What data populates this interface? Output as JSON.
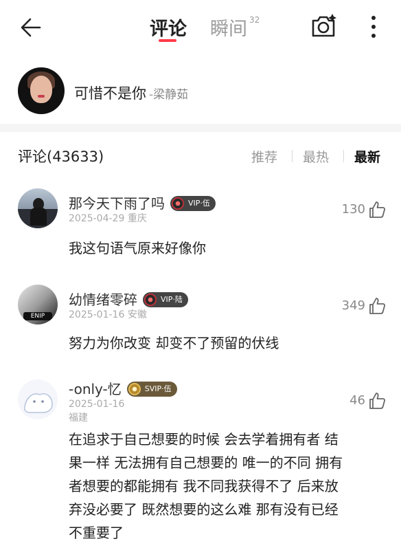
{
  "nav": {
    "tab_comments": "评论",
    "tab_moments": "瞬间",
    "moments_count": "32",
    "accent_color": "#ff3b4a"
  },
  "song": {
    "title": "可惜不是你",
    "separator": "-",
    "artist": "梁静茹"
  },
  "comments_header": {
    "label": "评论(43633)",
    "sort_options": [
      "推荐",
      "最热",
      "最新"
    ],
    "active_sort": "最新"
  },
  "comments": [
    {
      "username": "那今天下雨了吗",
      "vip_label": "VIP·伍",
      "date": "2025-04-29",
      "location": "重庆",
      "likes": "130",
      "text": "我这句语气原来好像你"
    },
    {
      "username": "幼情绪零碎",
      "vip_label": "VIP·陆",
      "date": "2025-01-16",
      "location": "安徽",
      "likes": "349",
      "text": "努力为你改变 却变不了预留的伏线"
    },
    {
      "username": "-only-忆",
      "vip_label": "SVIP·伍",
      "date": "2025-01-16",
      "location": "福建",
      "likes": "46",
      "text_lines": [
        "在追求于自己想要的时候 会去学着拥有者 结",
        "果一样 无法拥有自己想要的 唯一的不同 拥有",
        "者想要的都能拥有 我不同我获得不了 后来放",
        "弃没必要了 既然想要的这么难 那有没有已经",
        "不重要了"
      ]
    }
  ],
  "icons": {
    "back": "back-arrow-icon",
    "camera": "camera-sparkle-icon",
    "more": "more-vertical-icon",
    "like": "thumbs-up-icon",
    "vip": "vinyl-record-icon"
  }
}
